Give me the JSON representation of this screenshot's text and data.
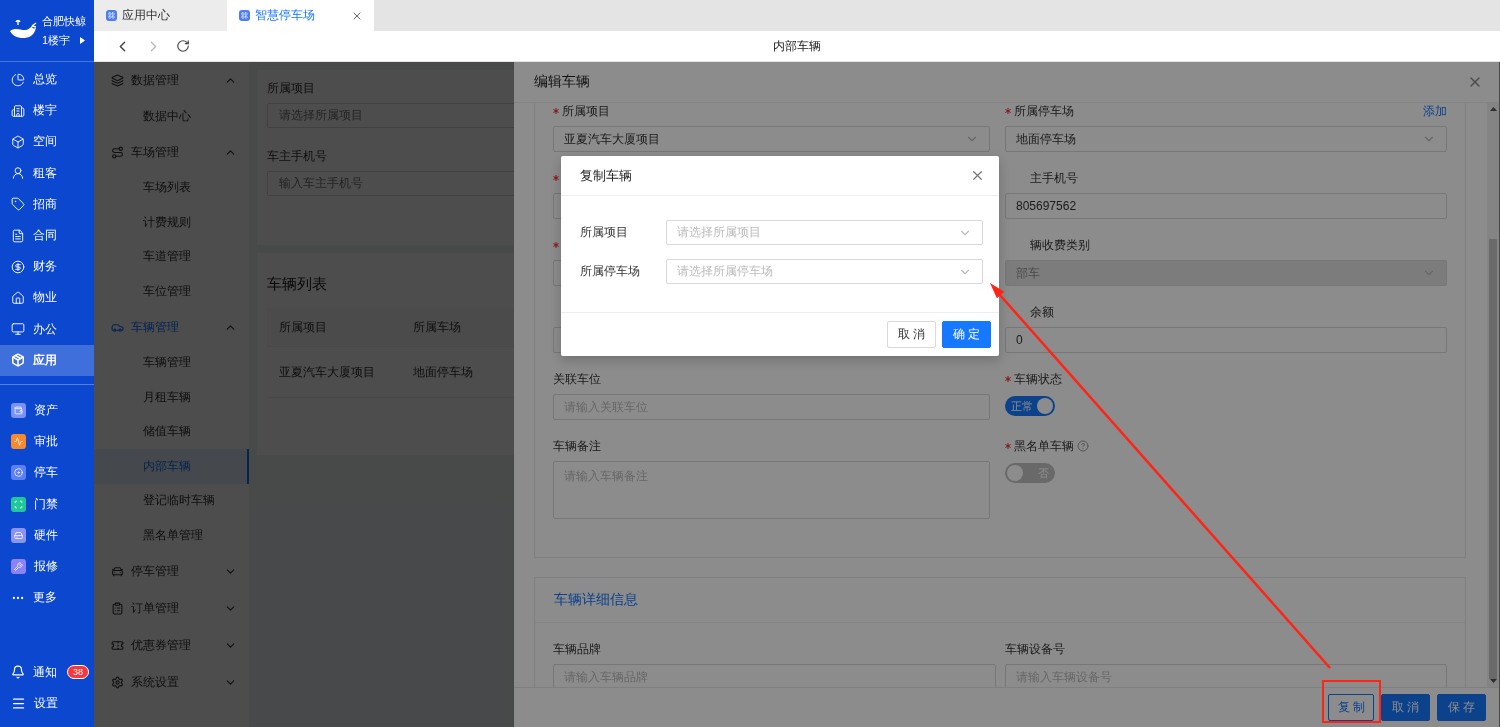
{
  "org": {
    "name": "合肥快鲸",
    "building": "1楼宇"
  },
  "nav": [
    {
      "label": "总览",
      "selected": false
    },
    {
      "label": "楼宇",
      "selected": false
    },
    {
      "label": "空间",
      "selected": false
    },
    {
      "label": "租客",
      "selected": false
    },
    {
      "label": "招商",
      "selected": false
    },
    {
      "label": "合同",
      "selected": false
    },
    {
      "label": "财务",
      "selected": false
    },
    {
      "label": "物业",
      "selected": false
    },
    {
      "label": "办公",
      "selected": false
    },
    {
      "label": "应用",
      "selected": true
    }
  ],
  "apps": [
    {
      "label": "资产",
      "color": "#7b93f6"
    },
    {
      "label": "审批",
      "color": "#f98a2c"
    },
    {
      "label": "停车",
      "color": "#5d7ff5"
    },
    {
      "label": "门禁",
      "color": "#1fc79a"
    },
    {
      "label": "硬件",
      "color": "#8c93f7"
    },
    {
      "label": "报修",
      "color": "#8b84f5"
    }
  ],
  "more": "更多",
  "footer_nav": {
    "notice": "通知",
    "badge": "38",
    "settings": "设置"
  },
  "tabs": [
    {
      "label": "应用中心",
      "selected": false
    },
    {
      "label": "智慧停车场",
      "selected": true
    }
  ],
  "browser": {
    "title": "内部车辆",
    "back_disabled": false,
    "forward_disabled": true
  },
  "menu": [
    {
      "label": "数据管理",
      "expanded": true,
      "selected": false,
      "children": [
        {
          "label": "数据中心",
          "selected": false
        }
      ]
    },
    {
      "label": "车场管理",
      "expanded": true,
      "selected": false,
      "children": [
        {
          "label": "车场列表",
          "selected": false
        },
        {
          "label": "计费规则",
          "selected": false
        },
        {
          "label": "车道管理",
          "selected": false
        },
        {
          "label": "车位管理",
          "selected": false
        }
      ]
    },
    {
      "label": "车辆管理",
      "expanded": true,
      "selected": true,
      "children": [
        {
          "label": "车辆管理",
          "selected": false
        },
        {
          "label": "月租车辆",
          "selected": false
        },
        {
          "label": "储值车辆",
          "selected": false
        },
        {
          "label": "内部车辆",
          "selected": true
        },
        {
          "label": "登记临时车辆",
          "selected": false
        },
        {
          "label": "黑名单管理",
          "selected": false
        }
      ]
    },
    {
      "label": "停车管理",
      "expanded": false,
      "selected": false
    },
    {
      "label": "订单管理",
      "expanded": false,
      "selected": false
    },
    {
      "label": "优惠券管理",
      "expanded": false,
      "selected": false
    },
    {
      "label": "系统设置",
      "expanded": false,
      "selected": false
    }
  ],
  "filters": [
    {
      "label": "所属项目",
      "placeholder": "请选择所属项目"
    },
    {
      "label": "车主手机号",
      "placeholder": "输入车主手机号"
    }
  ],
  "vehicle_list": {
    "title": "车辆列表",
    "columns": [
      "所属项目",
      "所属车场"
    ],
    "rows": [
      [
        "亚夏汽车大厦项目",
        "地面停车场"
      ]
    ]
  },
  "drawer": {
    "title": "编辑车辆",
    "left_fields": [
      {
        "kind": "select",
        "label": "所属项目",
        "required": true,
        "disabled": false,
        "value": "亚夏汽车大厦项目"
      },
      {
        "kind": "covered",
        "required": true,
        "disabled": false
      },
      {
        "kind": "covered",
        "required": true,
        "disabled": false
      },
      {
        "kind": "covered",
        "required": false,
        "disabled": false
      },
      {
        "kind": "input",
        "label": "关联车位",
        "required": false,
        "disabled": false,
        "placeholder": "请输入关联车位"
      },
      {
        "kind": "textarea",
        "label": "车辆备注",
        "required": false,
        "disabled": false,
        "placeholder": "请输入车辆备注"
      }
    ],
    "right_fields": [
      {
        "kind": "select",
        "label": "所属停车场",
        "clipped": false,
        "required": true,
        "disabled": false,
        "value": "地面停车场",
        "action": "添加"
      },
      {
        "kind": "input",
        "label": "主手机号",
        "clipped": true,
        "required": false,
        "disabled": false,
        "value": "805697562"
      },
      {
        "kind": "select",
        "label": "辆收费类别",
        "clipped": true,
        "required": false,
        "disabled": true,
        "value": "部车"
      },
      {
        "kind": "input",
        "label": "余额",
        "clipped": true,
        "required": false,
        "disabled": false,
        "value": "0"
      },
      {
        "kind": "switch",
        "label": "车辆状态",
        "clipped": false,
        "required": true,
        "on": true,
        "text": "正常"
      },
      {
        "kind": "switch",
        "label": "黑名单车辆",
        "clipped": false,
        "required": true,
        "on": false,
        "text": "否",
        "help": true
      }
    ],
    "detail": {
      "title": "车辆详细信息",
      "fields": [
        {
          "label": "车辆品牌",
          "placeholder": "请输入车辆品牌"
        },
        {
          "label": "车辆设备号",
          "placeholder": "请输入车辆设备号"
        }
      ]
    },
    "buttons": [
      {
        "label": "复制",
        "kind": "default"
      },
      {
        "label": "取消",
        "kind": "primary"
      },
      {
        "label": "保存",
        "kind": "primary"
      }
    ]
  },
  "dialog": {
    "title": "复制车辆",
    "fields": [
      {
        "label": "所属项目",
        "placeholder": "请选择所属项目"
      },
      {
        "label": "所属停车场",
        "placeholder": "请选择所属停车场"
      }
    ],
    "buttons": [
      {
        "label": "取消",
        "kind": "default"
      },
      {
        "label": "确定",
        "kind": "primary"
      }
    ]
  }
}
